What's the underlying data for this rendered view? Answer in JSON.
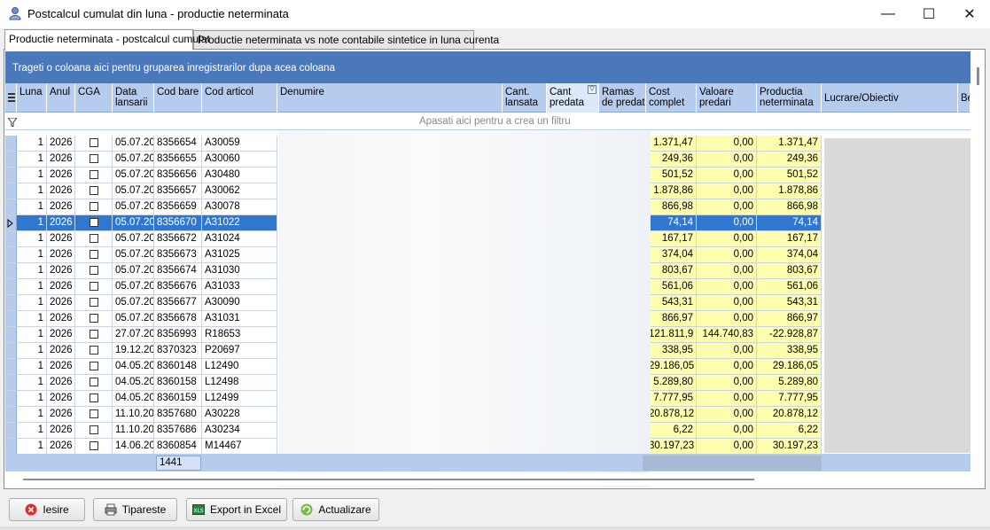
{
  "window": {
    "title": "Postcalcul cumulat din luna - productie neterminata",
    "minimize": "—",
    "maximize": "☐",
    "close": "✕"
  },
  "tabs": [
    {
      "label": "Productie neterminata - postcalcul cumulat",
      "active": true
    },
    {
      "label": "Productie neterminata vs note contabile sintetice in luna curenta",
      "active": false
    }
  ],
  "grid": {
    "group_hint": "Trageti o coloana aici pentru gruparea inregistrarilor dupa acea coloana",
    "filter_hint": "Apasati aici pentru a crea un filtru",
    "columns": {
      "luna": "Luna",
      "anul": "Anul",
      "cga": "CGA",
      "data_lansarii": "Data lansarii",
      "cod_bare": "Cod bare",
      "cod_articol": "Cod articol",
      "denumire": "Denumire",
      "cant_lansata": "Cant. lansata",
      "cant_predata": "Cant predata",
      "ramas_de_predat": "Ramas de predat",
      "cost_complet": "Cost complet",
      "valoare_predari": "Valoare predari",
      "productia_neterminata": "Productia neterminata",
      "lucrare_obiectiv": "Lucrare/Obiectiv",
      "next": "Be"
    },
    "rows": [
      {
        "luna": "1",
        "anul": "2026",
        "data": "05.07.20",
        "cod_bare": "8356654",
        "cod_articol": "A30059",
        "cost": "1.371,47",
        "valoare": "0,00",
        "prod": "1.371,47"
      },
      {
        "luna": "1",
        "anul": "2026",
        "data": "05.07.20",
        "cod_bare": "8356655",
        "cod_articol": "A30060",
        "cost": "249,36",
        "valoare": "0,00",
        "prod": "249,36"
      },
      {
        "luna": "1",
        "anul": "2026",
        "data": "05.07.20",
        "cod_bare": "8356656",
        "cod_articol": "A30480",
        "cost": "501,52",
        "valoare": "0,00",
        "prod": "501,52"
      },
      {
        "luna": "1",
        "anul": "2026",
        "data": "05.07.20",
        "cod_bare": "8356657",
        "cod_articol": "A30062",
        "cost": "1.878,86",
        "valoare": "0,00",
        "prod": "1.878,86"
      },
      {
        "luna": "1",
        "anul": "2026",
        "data": "05.07.20",
        "cod_bare": "8356659",
        "cod_articol": "A30078",
        "cost": "866,98",
        "valoare": "0,00",
        "prod": "866,98"
      },
      {
        "luna": "1",
        "anul": "2026",
        "data": "05.07.20",
        "cod_bare": "8356670",
        "cod_articol": "A31022",
        "cost": "74,14",
        "valoare": "0,00",
        "prod": "74,14"
      },
      {
        "luna": "1",
        "anul": "2026",
        "data": "05.07.20",
        "cod_bare": "8356672",
        "cod_articol": "A31024",
        "cost": "167,17",
        "valoare": "0,00",
        "prod": "167,17"
      },
      {
        "luna": "1",
        "anul": "2026",
        "data": "05.07.20",
        "cod_bare": "8356673",
        "cod_articol": "A31025",
        "cost": "374,04",
        "valoare": "0,00",
        "prod": "374,04"
      },
      {
        "luna": "1",
        "anul": "2026",
        "data": "05.07.20",
        "cod_bare": "8356674",
        "cod_articol": "A31030",
        "cost": "803,67",
        "valoare": "0,00",
        "prod": "803,67"
      },
      {
        "luna": "1",
        "anul": "2026",
        "data": "05.07.20",
        "cod_bare": "8356676",
        "cod_articol": "A31033",
        "cost": "561,06",
        "valoare": "0,00",
        "prod": "561,06"
      },
      {
        "luna": "1",
        "anul": "2026",
        "data": "05.07.20",
        "cod_bare": "8356677",
        "cod_articol": "A30090",
        "cost": "543,31",
        "valoare": "0,00",
        "prod": "543,31"
      },
      {
        "luna": "1",
        "anul": "2026",
        "data": "05.07.20",
        "cod_bare": "8356678",
        "cod_articol": "A31031",
        "cost": "866,97",
        "valoare": "0,00",
        "prod": "866,97"
      },
      {
        "luna": "1",
        "anul": "2026",
        "data": "27.07.20",
        "cod_bare": "8356993",
        "cod_articol": "R18653",
        "cost": "121.811,9",
        "valoare": "144.740,83",
        "prod": "-22.928,87"
      },
      {
        "luna": "1",
        "anul": "2026",
        "data": "19.12.20",
        "cod_bare": "8370323",
        "cod_articol": "P20697",
        "cost": "338,95",
        "valoare": "0,00",
        "prod": "338,95"
      },
      {
        "luna": "1",
        "anul": "2026",
        "data": "04.05.20",
        "cod_bare": "8360148",
        "cod_articol": "L12490",
        "cost": "29.186,05",
        "valoare": "0,00",
        "prod": "29.186,05"
      },
      {
        "luna": "1",
        "anul": "2026",
        "data": "04.05.20",
        "cod_bare": "8360158",
        "cod_articol": "L12498",
        "cost": "5.289,80",
        "valoare": "0,00",
        "prod": "5.289,80"
      },
      {
        "luna": "1",
        "anul": "2026",
        "data": "04.05.20",
        "cod_bare": "8360159",
        "cod_articol": "L12499",
        "cost": "7.777,95",
        "valoare": "0,00",
        "prod": "7.777,95"
      },
      {
        "luna": "1",
        "anul": "2026",
        "data": "11.10.20",
        "cod_bare": "8357680",
        "cod_articol": "A30228",
        "cost": "20.878,12",
        "valoare": "0,00",
        "prod": "20.878,12"
      },
      {
        "luna": "1",
        "anul": "2026",
        "data": "11.10.20",
        "cod_bare": "8357686",
        "cod_articol": "A30234",
        "cost": "6,22",
        "valoare": "0,00",
        "prod": "6,22"
      },
      {
        "luna": "1",
        "anul": "2026",
        "data": "14.06.20",
        "cod_bare": "8360854",
        "cod_articol": "M14467",
        "cost": "30.197,23",
        "valoare": "0,00",
        "prod": "30.197,23"
      }
    ],
    "selected_row": 5,
    "footer_count": "1441"
  },
  "buttons": {
    "iesire": "Iesire",
    "tipareste": "Tipareste",
    "export": "Export in Excel",
    "actualizare": "Actualizare"
  },
  "colors": {
    "group_panel": "#4b78bb",
    "header": "#b6ccee",
    "selection": "#2f77cf",
    "highlight_cells": "#fdfdae"
  }
}
